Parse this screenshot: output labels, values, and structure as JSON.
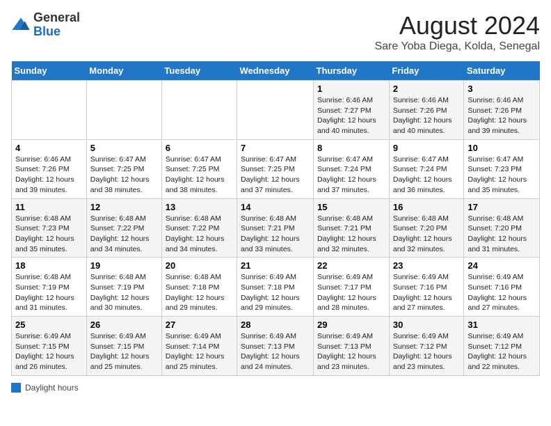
{
  "header": {
    "logo_general": "General",
    "logo_blue": "Blue",
    "title": "August 2024",
    "subtitle": "Sare Yoba Diega, Kolda, Senegal"
  },
  "legend": {
    "label": "Daylight hours"
  },
  "days_of_week": [
    "Sunday",
    "Monday",
    "Tuesday",
    "Wednesday",
    "Thursday",
    "Friday",
    "Saturday"
  ],
  "weeks": [
    [
      {
        "num": "",
        "info": ""
      },
      {
        "num": "",
        "info": ""
      },
      {
        "num": "",
        "info": ""
      },
      {
        "num": "",
        "info": ""
      },
      {
        "num": "1",
        "info": "Sunrise: 6:46 AM\nSunset: 7:27 PM\nDaylight: 12 hours and 40 minutes."
      },
      {
        "num": "2",
        "info": "Sunrise: 6:46 AM\nSunset: 7:26 PM\nDaylight: 12 hours and 40 minutes."
      },
      {
        "num": "3",
        "info": "Sunrise: 6:46 AM\nSunset: 7:26 PM\nDaylight: 12 hours and 39 minutes."
      }
    ],
    [
      {
        "num": "4",
        "info": "Sunrise: 6:46 AM\nSunset: 7:26 PM\nDaylight: 12 hours and 39 minutes."
      },
      {
        "num": "5",
        "info": "Sunrise: 6:47 AM\nSunset: 7:25 PM\nDaylight: 12 hours and 38 minutes."
      },
      {
        "num": "6",
        "info": "Sunrise: 6:47 AM\nSunset: 7:25 PM\nDaylight: 12 hours and 38 minutes."
      },
      {
        "num": "7",
        "info": "Sunrise: 6:47 AM\nSunset: 7:25 PM\nDaylight: 12 hours and 37 minutes."
      },
      {
        "num": "8",
        "info": "Sunrise: 6:47 AM\nSunset: 7:24 PM\nDaylight: 12 hours and 37 minutes."
      },
      {
        "num": "9",
        "info": "Sunrise: 6:47 AM\nSunset: 7:24 PM\nDaylight: 12 hours and 36 minutes."
      },
      {
        "num": "10",
        "info": "Sunrise: 6:47 AM\nSunset: 7:23 PM\nDaylight: 12 hours and 35 minutes."
      }
    ],
    [
      {
        "num": "11",
        "info": "Sunrise: 6:48 AM\nSunset: 7:23 PM\nDaylight: 12 hours and 35 minutes."
      },
      {
        "num": "12",
        "info": "Sunrise: 6:48 AM\nSunset: 7:22 PM\nDaylight: 12 hours and 34 minutes."
      },
      {
        "num": "13",
        "info": "Sunrise: 6:48 AM\nSunset: 7:22 PM\nDaylight: 12 hours and 34 minutes."
      },
      {
        "num": "14",
        "info": "Sunrise: 6:48 AM\nSunset: 7:21 PM\nDaylight: 12 hours and 33 minutes."
      },
      {
        "num": "15",
        "info": "Sunrise: 6:48 AM\nSunset: 7:21 PM\nDaylight: 12 hours and 32 minutes."
      },
      {
        "num": "16",
        "info": "Sunrise: 6:48 AM\nSunset: 7:20 PM\nDaylight: 12 hours and 32 minutes."
      },
      {
        "num": "17",
        "info": "Sunrise: 6:48 AM\nSunset: 7:20 PM\nDaylight: 12 hours and 31 minutes."
      }
    ],
    [
      {
        "num": "18",
        "info": "Sunrise: 6:48 AM\nSunset: 7:19 PM\nDaylight: 12 hours and 31 minutes."
      },
      {
        "num": "19",
        "info": "Sunrise: 6:48 AM\nSunset: 7:19 PM\nDaylight: 12 hours and 30 minutes."
      },
      {
        "num": "20",
        "info": "Sunrise: 6:48 AM\nSunset: 7:18 PM\nDaylight: 12 hours and 29 minutes."
      },
      {
        "num": "21",
        "info": "Sunrise: 6:49 AM\nSunset: 7:18 PM\nDaylight: 12 hours and 29 minutes."
      },
      {
        "num": "22",
        "info": "Sunrise: 6:49 AM\nSunset: 7:17 PM\nDaylight: 12 hours and 28 minutes."
      },
      {
        "num": "23",
        "info": "Sunrise: 6:49 AM\nSunset: 7:16 PM\nDaylight: 12 hours and 27 minutes."
      },
      {
        "num": "24",
        "info": "Sunrise: 6:49 AM\nSunset: 7:16 PM\nDaylight: 12 hours and 27 minutes."
      }
    ],
    [
      {
        "num": "25",
        "info": "Sunrise: 6:49 AM\nSunset: 7:15 PM\nDaylight: 12 hours and 26 minutes."
      },
      {
        "num": "26",
        "info": "Sunrise: 6:49 AM\nSunset: 7:15 PM\nDaylight: 12 hours and 25 minutes."
      },
      {
        "num": "27",
        "info": "Sunrise: 6:49 AM\nSunset: 7:14 PM\nDaylight: 12 hours and 25 minutes."
      },
      {
        "num": "28",
        "info": "Sunrise: 6:49 AM\nSunset: 7:13 PM\nDaylight: 12 hours and 24 minutes."
      },
      {
        "num": "29",
        "info": "Sunrise: 6:49 AM\nSunset: 7:13 PM\nDaylight: 12 hours and 23 minutes."
      },
      {
        "num": "30",
        "info": "Sunrise: 6:49 AM\nSunset: 7:12 PM\nDaylight: 12 hours and 23 minutes."
      },
      {
        "num": "31",
        "info": "Sunrise: 6:49 AM\nSunset: 7:12 PM\nDaylight: 12 hours and 22 minutes."
      }
    ]
  ]
}
